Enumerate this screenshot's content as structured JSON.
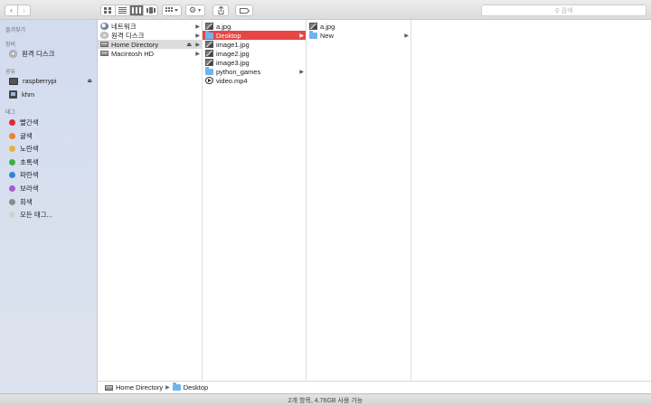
{
  "toolbar": {
    "back_icon": "chevron-left-icon",
    "forward_icon": "chevron-right-icon",
    "views": [
      "icon-view",
      "list-view",
      "column-view",
      "cover-flow-view"
    ],
    "active_view": "column-view",
    "search_placeholder": "검색"
  },
  "sidebar": {
    "favorites_header": "즐겨찾기",
    "devices_header": "장비",
    "devices": [
      {
        "label": "원격 디스크"
      }
    ],
    "shared_header": "공유",
    "shared": [
      {
        "label": "raspberrypi"
      },
      {
        "label": "khm"
      }
    ],
    "tags_header": "태그",
    "tags": [
      {
        "label": "빨간색",
        "color": "#e0283a"
      },
      {
        "label": "귤색",
        "color": "#e8862a"
      },
      {
        "label": "노란색",
        "color": "#e0b43a"
      },
      {
        "label": "초록색",
        "color": "#3fae3f"
      },
      {
        "label": "파란색",
        "color": "#2b88de"
      },
      {
        "label": "보라색",
        "color": "#a45bd3"
      },
      {
        "label": "회색",
        "color": "#8b8b8b"
      },
      {
        "label": "모든 태그...",
        "color": "#d0d0d0"
      }
    ]
  },
  "columns": {
    "col1": [
      {
        "label": "네트워크"
      },
      {
        "label": "원격 디스크"
      },
      {
        "label": "Home Directory"
      },
      {
        "label": "Macintosh HD"
      }
    ],
    "col2": [
      {
        "label": "a.jpg"
      },
      {
        "label": "Desktop"
      },
      {
        "label": "image1.jpg"
      },
      {
        "label": "image2.jpg"
      },
      {
        "label": "image3.jpg"
      },
      {
        "label": "python_games"
      },
      {
        "label": "video.mp4"
      }
    ],
    "col3": [
      {
        "label": "a.jpg"
      },
      {
        "label": "New"
      }
    ]
  },
  "pathbar": {
    "items": [
      "Home Directory",
      "Desktop"
    ]
  },
  "statusbar": {
    "text": "2개 항목, 4.76GB 사용 가능"
  }
}
